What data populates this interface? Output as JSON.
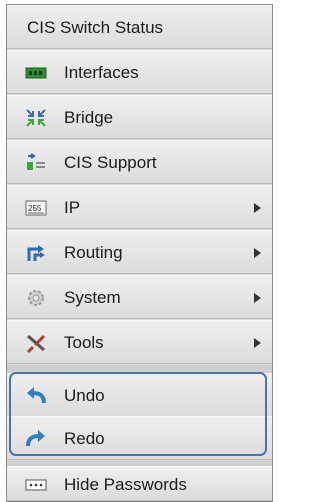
{
  "menu": {
    "header": "CIS Switch Status",
    "items": [
      {
        "label": "Interfaces",
        "icon": "interfaces-icon",
        "has_submenu": false
      },
      {
        "label": "Bridge",
        "icon": "bridge-icon",
        "has_submenu": false
      },
      {
        "label": "CIS Support",
        "icon": "cis-support-icon",
        "has_submenu": false
      },
      {
        "label": "IP",
        "icon": "ip-icon",
        "has_submenu": true
      },
      {
        "label": "Routing",
        "icon": "routing-icon",
        "has_submenu": true
      },
      {
        "label": "System",
        "icon": "system-icon",
        "has_submenu": true
      },
      {
        "label": "Tools",
        "icon": "tools-icon",
        "has_submenu": true
      }
    ],
    "history": [
      {
        "label": "Undo",
        "icon": "undo-icon"
      },
      {
        "label": "Redo",
        "icon": "redo-icon"
      }
    ],
    "footer": {
      "label": "Hide Passwords",
      "icon": "hide-passwords-icon"
    }
  },
  "colors": {
    "highlight_border": "#4a73a8",
    "menu_background": "#e6e6e6",
    "text": "#1b1b1b"
  }
}
